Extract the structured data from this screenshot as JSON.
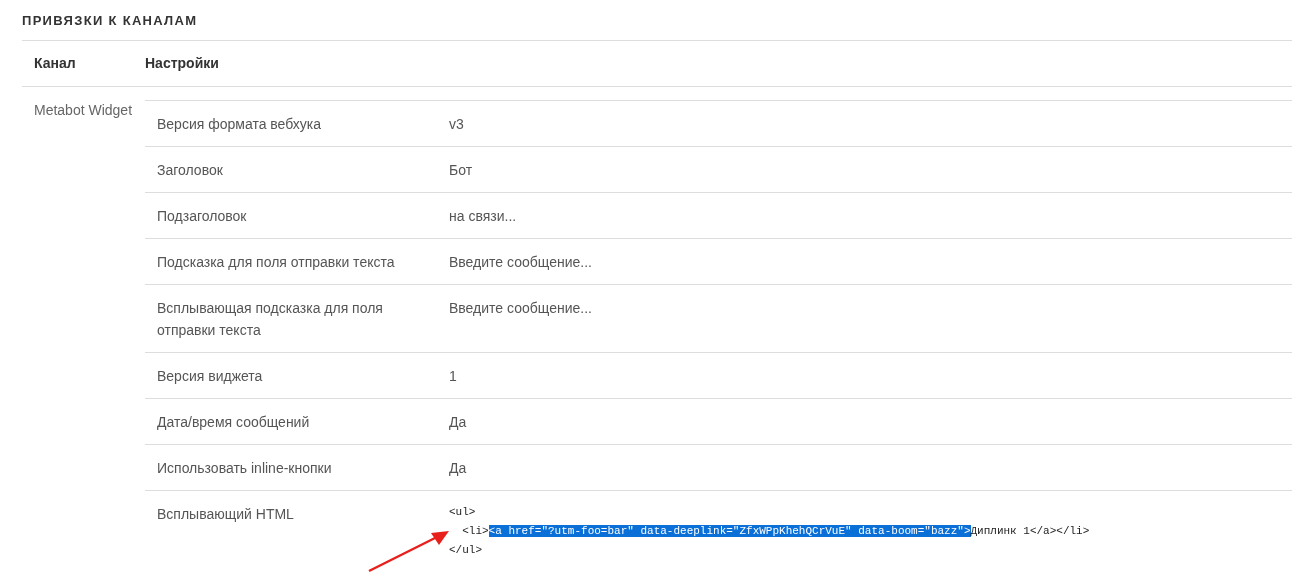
{
  "section_title": "ПРИВЯЗКИ К КАНАЛАМ",
  "table": {
    "columns": [
      "Канал",
      "Настройки"
    ],
    "rows": [
      {
        "channel": "Metabot Widget",
        "settings": [
          {
            "label": "Версия формата вебхука",
            "value": "v3"
          },
          {
            "label": "Заголовок",
            "value": "Бот"
          },
          {
            "label": "Подзаголовок",
            "value": "на связи..."
          },
          {
            "label": "Подсказка для поля отправки текста",
            "value": "Введите сообщение..."
          },
          {
            "label": "Всплывающая подсказка для поля отправки текста",
            "value": "Введите сообщение..."
          },
          {
            "label": "Версия виджета",
            "value": "1"
          },
          {
            "label": "Дата/время сообщений",
            "value": "Да"
          },
          {
            "label": "Использовать inline-кнопки",
            "value": "Да"
          },
          {
            "label": "Всплывающий HTML",
            "kind": "code",
            "code_lines": [
              [
                {
                  "text": "<ul>",
                  "selected": false
                }
              ],
              [
                {
                  "text": "  <li>",
                  "selected": false
                },
                {
                  "text": "<a href=\"?utm-foo=bar\" data-deeplink=\"ZfxWPpKhehQCrVuE\" data-boom=\"bazz\">",
                  "selected": true
                },
                {
                  "text": "Диплинк 1</a></li>",
                  "selected": false
                }
              ],
              [
                {
                  "text": "</ul>",
                  "selected": false
                }
              ]
            ]
          }
        ]
      }
    ]
  }
}
